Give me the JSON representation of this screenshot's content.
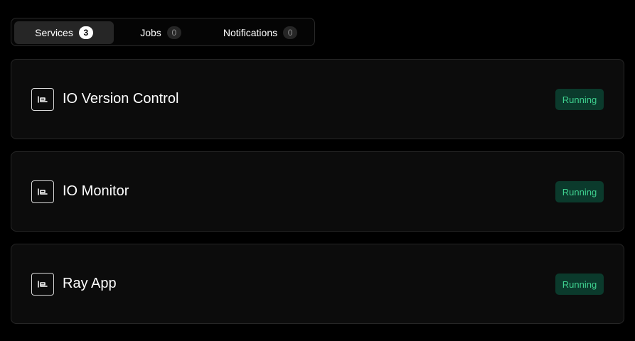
{
  "tabs": {
    "services": {
      "label": "Services",
      "count": "3"
    },
    "jobs": {
      "label": "Jobs",
      "count": "0"
    },
    "notifications": {
      "label": "Notifications",
      "count": "0"
    }
  },
  "services": [
    {
      "name": "IO Version Control",
      "status": "Running",
      "icon": "service-icon"
    },
    {
      "name": "IO Monitor",
      "status": "Running",
      "icon": "service-icon"
    },
    {
      "name": "Ray App",
      "status": "Running",
      "icon": "service-icon"
    }
  ],
  "colors": {
    "background": "#000000",
    "card_background": "#0c0c0c",
    "status_running_text": "#3ecf8e",
    "status_running_background": "#0b3a2c"
  }
}
